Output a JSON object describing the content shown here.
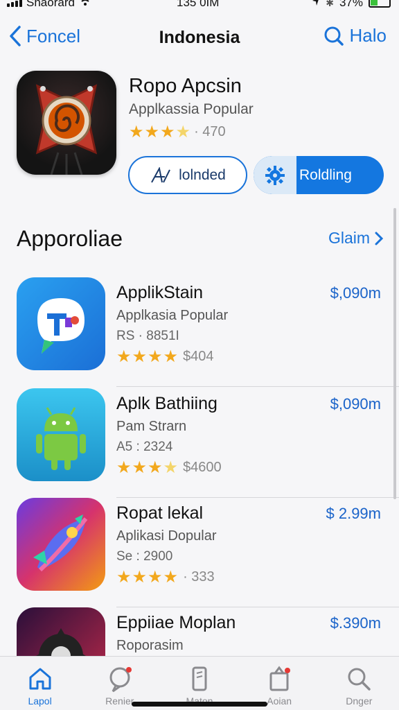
{
  "status": {
    "carrier": "Snaorard",
    "time": "135 0IM",
    "battery": "37%"
  },
  "nav": {
    "back_label": "Foncel",
    "title": "Indonesia",
    "search_label": "Halo"
  },
  "featured": {
    "name": "Ropo Apcsin",
    "subtitle": "Applkassia Popular",
    "rating_text": "· 470",
    "rating": 3.5,
    "button_outline_label": "lolnded",
    "button_fill_label": "Roldling"
  },
  "section": {
    "title": "Apporoliae",
    "see_all": "Glaim"
  },
  "apps": [
    {
      "name": "ApplikStain",
      "subtitle": "Applkasia Popular",
      "meta": "RS · 8851I",
      "rating": 4,
      "rating_text": "$404",
      "price": "$,090m"
    },
    {
      "name": "Aplk Bathiing",
      "subtitle": "Pam Strarn",
      "meta": "A5 : 2324",
      "rating": 3.5,
      "rating_text": "$4600",
      "price": "$,090m"
    },
    {
      "name": "Ropat lekal",
      "subtitle": "Aplikasi Dopular",
      "meta": "Se : 2900",
      "rating": 4,
      "rating_text": "· 333",
      "price": "$ 2.99m"
    },
    {
      "name": "Eppiiae Moplan",
      "subtitle": "Roporasim",
      "meta": "",
      "rating": 0,
      "rating_text": "",
      "price": "$.390m"
    }
  ],
  "tabs": [
    {
      "label": "Lapol",
      "icon": "home-icon"
    },
    {
      "label": "Renier",
      "icon": "chat-icon"
    },
    {
      "label": "Maton",
      "icon": "phone-icon"
    },
    {
      "label": "Aoian",
      "icon": "bag-icon"
    },
    {
      "label": "Dnger",
      "icon": "search-icon"
    }
  ],
  "colors": {
    "accent": "#1a73d9",
    "star": "#f2a81d"
  }
}
